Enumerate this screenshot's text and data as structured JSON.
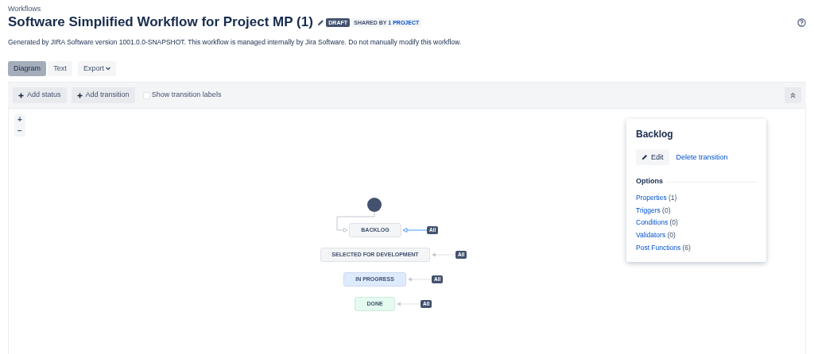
{
  "breadcrumb": "Workflows",
  "title": "Software Simplified Workflow for Project MP (1)",
  "badges": [
    {
      "kind": "status",
      "text": "DRAFT"
    },
    {
      "kind": "shared",
      "text": "SHARED BY",
      "link": "1 PROJECT"
    }
  ],
  "description": "Generated by JIRA Software version 1001.0.0-SNAPSHOT. This workflow is managed internally by Jira Software. Do not manually modify this workflow.",
  "view_tabs": [
    {
      "label": "Diagram",
      "selected": true
    },
    {
      "label": "Text",
      "selected": false
    }
  ],
  "export_button": "Export",
  "toolbar": {
    "buttons": [
      "Add status",
      "Add transition"
    ],
    "checkbox": {
      "label": "Show transition labels",
      "checked": false
    }
  },
  "zoom": [
    "+",
    "−"
  ],
  "statuses": [
    {
      "name": "BACKLOG",
      "color": "#f4f5f7",
      "transition": {
        "label": "All",
        "selected": true
      }
    },
    {
      "name": "SELECTED FOR DEVELOPMENT",
      "color": "#f4f5f7",
      "transition": {
        "label": "All",
        "selected": false
      }
    },
    {
      "name": "IN PROGRESS",
      "color": "#deebff",
      "transition": {
        "label": "All",
        "selected": false
      }
    },
    {
      "name": "DONE",
      "color": "#e3fcef",
      "transition": {
        "label": "All",
        "selected": false
      }
    }
  ],
  "panel": {
    "title": "Backlog",
    "edit_button": "Edit",
    "delete_link": "Delete transition",
    "options_heading": "Options",
    "options": [
      {
        "label": "Properties",
        "count": "(1)"
      },
      {
        "label": "Triggers",
        "count": "(0)"
      },
      {
        "label": "Conditions",
        "count": "(0)"
      },
      {
        "label": "Validators",
        "count": "(0)"
      },
      {
        "label": "Post Functions",
        "count": "(6)"
      }
    ]
  }
}
